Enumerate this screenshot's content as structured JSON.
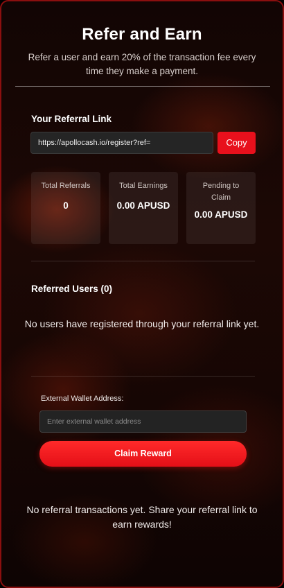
{
  "header": {
    "title": "Refer and Earn",
    "subtitle": "Refer a user and earn 20% of the transaction fee every time they make a payment."
  },
  "referral_link": {
    "section_label": "Your Referral Link",
    "value": "https://apollocash.io/register?ref=",
    "copy_label": "Copy"
  },
  "stats": [
    {
      "label": "Total Referrals",
      "value": "0"
    },
    {
      "label": "Total Earnings",
      "value": "0.00 APUSD"
    },
    {
      "label": "Pending to Claim",
      "value": "0.00 APUSD"
    }
  ],
  "referred_users": {
    "heading": "Referred Users (0)",
    "empty_message": "No users have registered through your referral link yet."
  },
  "claim": {
    "field_label": "External Wallet Address:",
    "placeholder": "Enter external wallet address",
    "button_label": "Claim Reward"
  },
  "transactions": {
    "empty_message": "No referral transactions yet. Share your referral link to earn rewards!"
  },
  "colors": {
    "accent": "#e8101c",
    "border": "#8b0f0f",
    "background": "#160604"
  }
}
